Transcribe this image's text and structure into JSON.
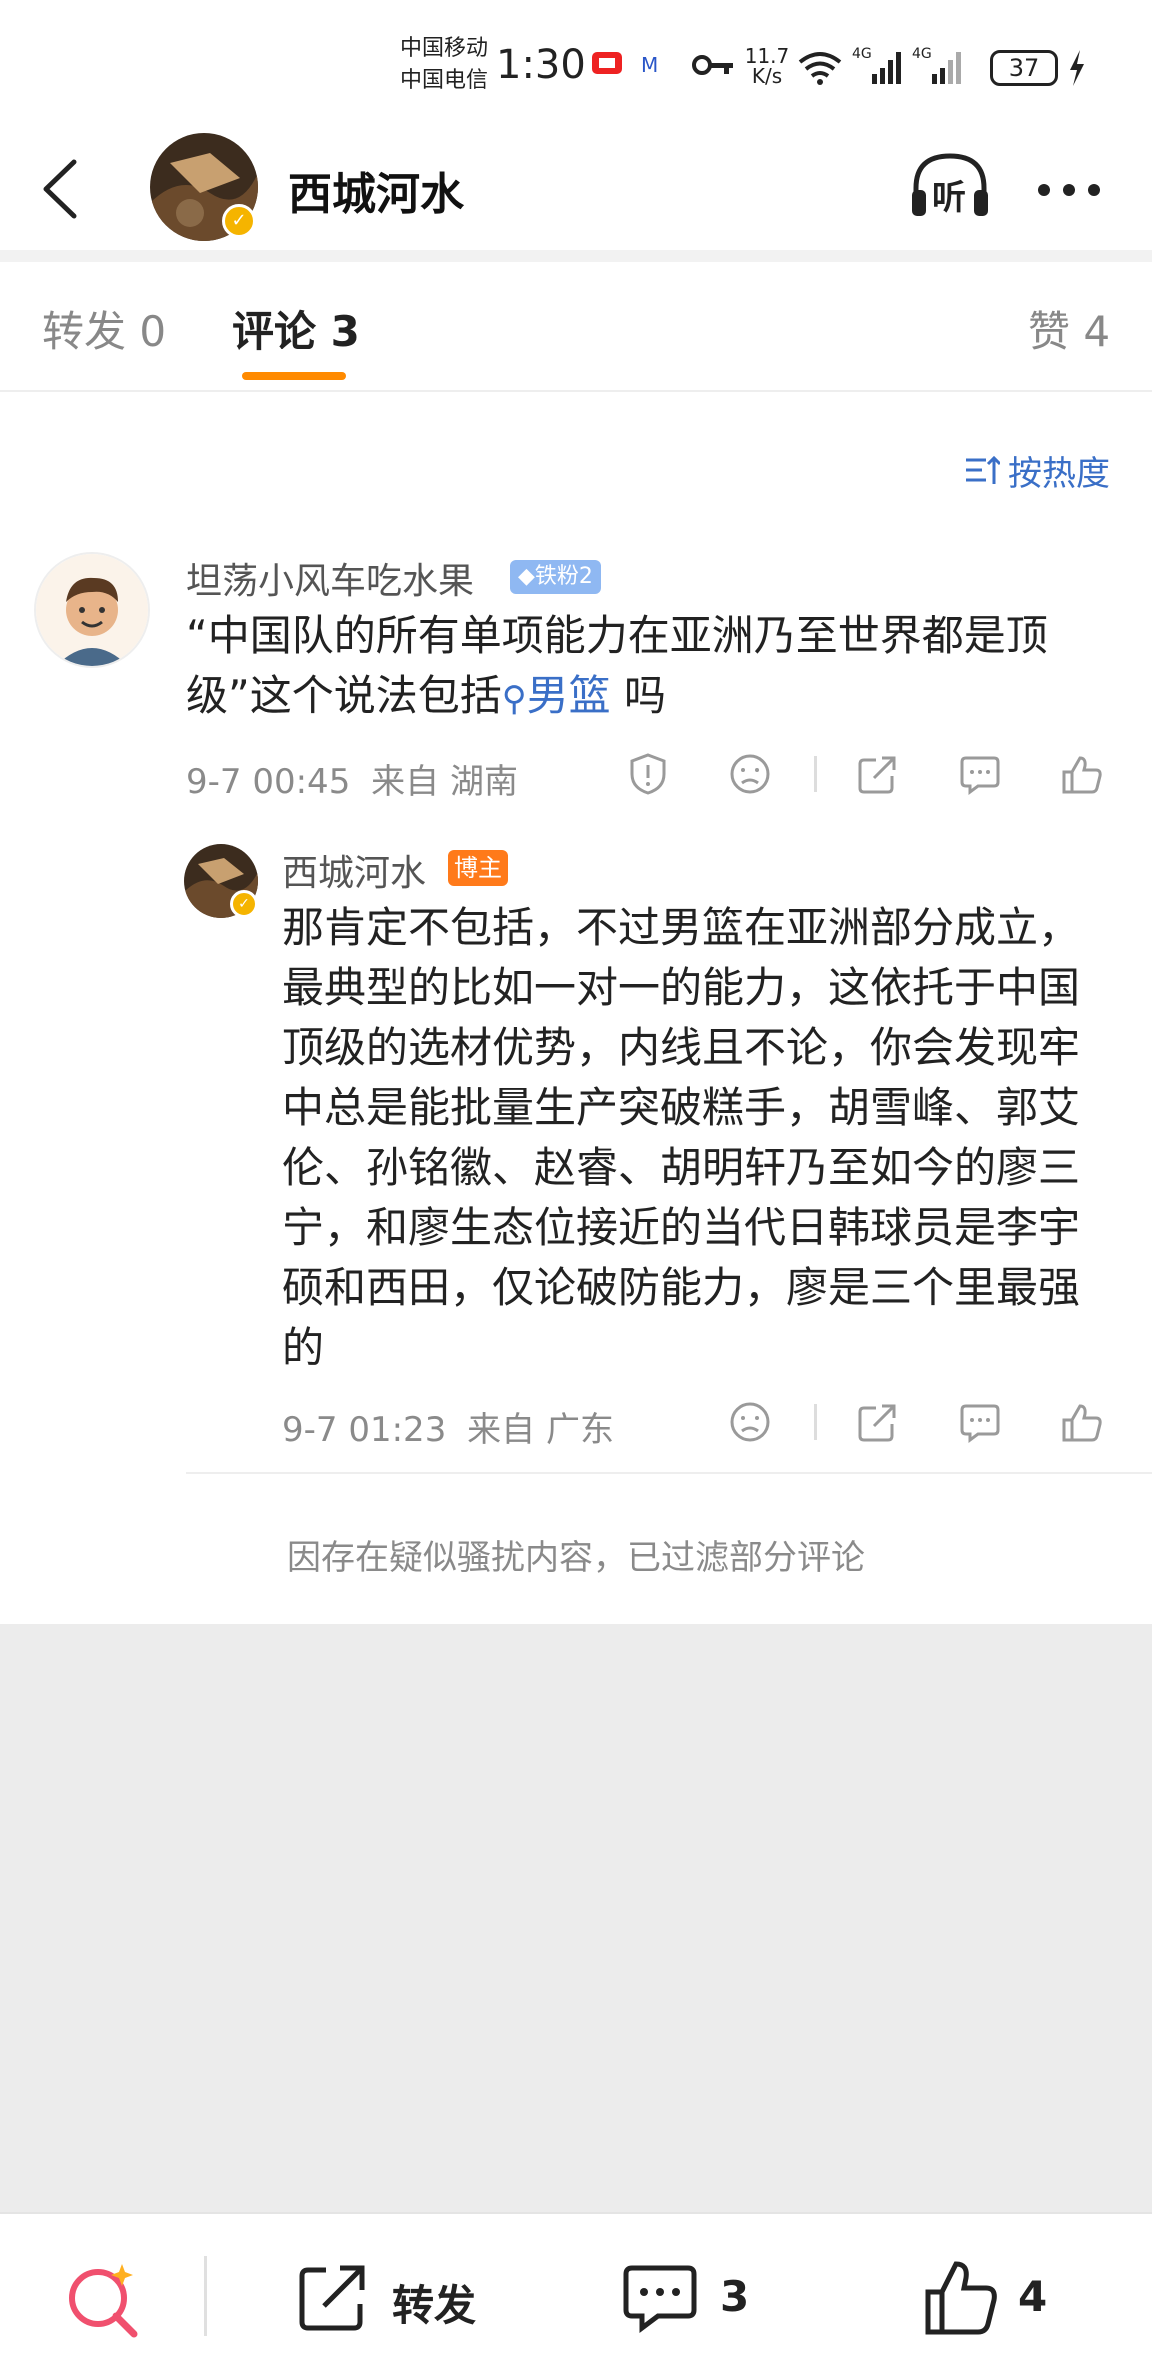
{
  "status_bar": {
    "carrier1": "中国移动",
    "carrier2": "中国电信",
    "time": "1:30",
    "net_speed_value": "11.7",
    "net_speed_unit": "K/s",
    "battery": "37"
  },
  "header": {
    "title": "西城河水",
    "listen_label": "听"
  },
  "tabs": {
    "repost": "转发 0",
    "comment": "评论 3",
    "like": "赞 4"
  },
  "sort_label": "按热度",
  "comments": [
    {
      "username": "坦荡小风车吃水果",
      "badge": "铁粉2",
      "text_part1": "“中国队的所有单项能力在亚洲乃至世界都是顶级”这个说法包括",
      "topic": "男篮",
      "text_part2": " 吗",
      "time": "9-7 00:45",
      "location": "来自 湖南"
    }
  ],
  "reply": {
    "username": "西城河水",
    "badge": "博主",
    "text": "那肯定不包括，不过男篮在亚洲部分成立，最典型的比如一对一的能力，这依托于中国顶级的选材优势，内线且不论，你会发现牢中总是能批量生产突破糕手，胡雪峰、郭艾伦、孙铭徽、赵睿、胡明轩乃至如今的廖三宁，和廖生态位接近的当代日韩球员是李宇硕和西田，仅论破防能力，廖是三个里最强的",
    "time": "9-7 01:23",
    "location": "来自 广东"
  },
  "filter_note": "因存在疑似骚扰内容，已过滤部分评论",
  "bottom_bar": {
    "repost_label": "转发",
    "comment_count": "3",
    "like_count": "4"
  },
  "colors": {
    "accent_orange": "#ff8a00",
    "link_blue": "#3a6fc7",
    "gray_bg": "#ececec"
  }
}
